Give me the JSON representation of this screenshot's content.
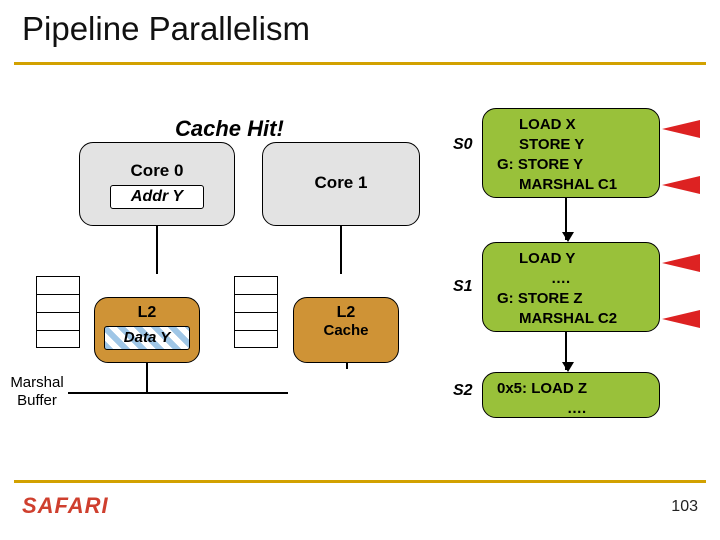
{
  "title": "Pipeline Parallelism",
  "cache_hit": "Cache Hit!",
  "core0": {
    "label": "Core 0",
    "addr": "Addr Y"
  },
  "core1": {
    "label": "Core 1"
  },
  "l2_0": {
    "label": "L2",
    "data": "Data Y"
  },
  "l2_1": {
    "label": "L2",
    "sub": "Cache"
  },
  "marshal": "Marshal\nBuffer",
  "stages": {
    "s0": {
      "label": "S0",
      "lines": [
        "LOAD X",
        "STORE Y",
        "G: STORE Y",
        "MARSHAL C1"
      ]
    },
    "s1": {
      "label": "S1",
      "lines": [
        "LOAD Y",
        "….",
        "G: STORE Z",
        "MARSHAL C2"
      ]
    },
    "s2": {
      "label": "S2",
      "lines": [
        "0x5: LOAD Z",
        "…."
      ]
    }
  },
  "footer": {
    "logo": "SAFARI",
    "page": "103"
  }
}
